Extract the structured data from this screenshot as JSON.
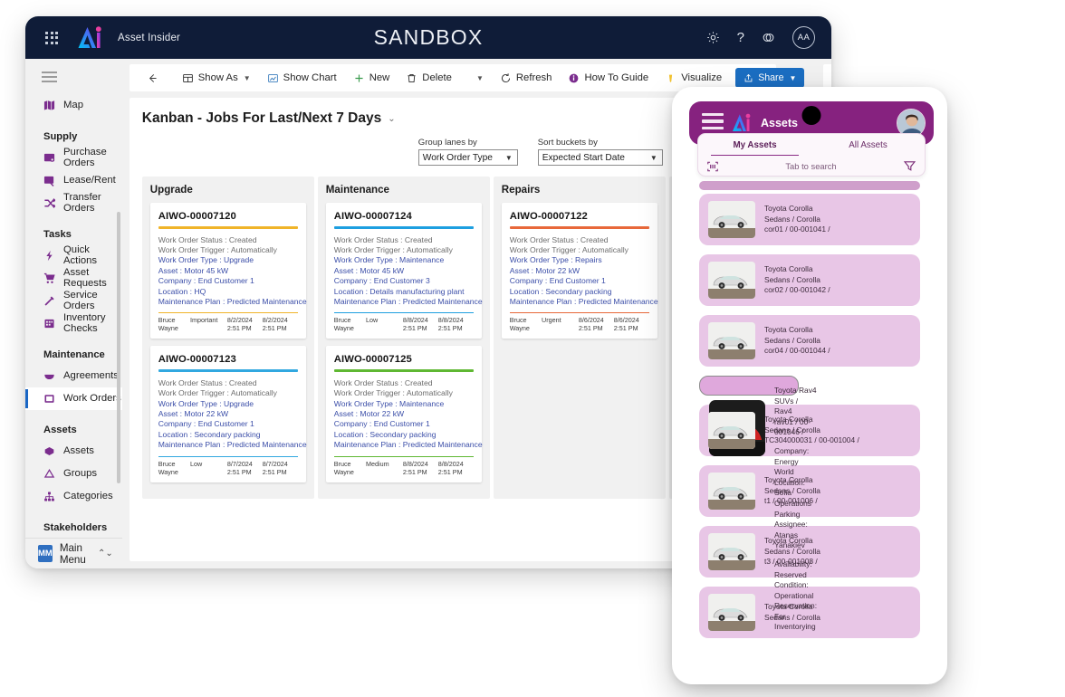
{
  "app": {
    "brand_name": "Asset Insider",
    "environment_label": "SANDBOX",
    "avatar_initials": "AA",
    "icons": {
      "waffle": "app-launcher-icon",
      "settings": "gear-icon",
      "help": "question-mark-icon",
      "feedback": "feedback-icon"
    }
  },
  "sidebar": {
    "top_items": [
      {
        "label": "Map",
        "icon": "map-icon"
      }
    ],
    "groups": [
      {
        "title": "Supply",
        "items": [
          {
            "label": "Purchase Orders",
            "icon": "purchase-order-icon"
          },
          {
            "label": "Lease/Rent",
            "icon": "lease-rent-icon"
          },
          {
            "label": "Transfer Orders",
            "icon": "transfer-icon"
          }
        ]
      },
      {
        "title": "Tasks",
        "items": [
          {
            "label": "Quick Actions",
            "icon": "lightning-icon"
          },
          {
            "label": "Asset Requests",
            "icon": "cart-icon"
          },
          {
            "label": "Service Orders",
            "icon": "wrench-icon"
          },
          {
            "label": "Inventory Checks",
            "icon": "clipboard-icon"
          }
        ]
      },
      {
        "title": "Maintenance",
        "items": [
          {
            "label": "Agreements",
            "icon": "agreement-icon"
          },
          {
            "label": "Work Orders",
            "icon": "work-order-icon",
            "active": true
          }
        ]
      },
      {
        "title": "Assets",
        "items": [
          {
            "label": "Assets",
            "icon": "asset-icon"
          },
          {
            "label": "Groups",
            "icon": "group-icon"
          },
          {
            "label": "Categories",
            "icon": "category-icon"
          }
        ]
      },
      {
        "title": "Stakeholders",
        "items": []
      }
    ],
    "footer": {
      "badge": "MM",
      "label": "Main Menu"
    }
  },
  "toolbar": {
    "back_label": "",
    "show_as": "Show As",
    "show_chart": "Show Chart",
    "new": "New",
    "delete": "Delete",
    "refresh": "Refresh",
    "how_to_guide": "How To Guide",
    "visualize": "Visualize",
    "share": "Share"
  },
  "view": {
    "title": "Kanban - Jobs For Last/Next 7 Days",
    "group_lanes_by": {
      "label": "Group lanes by",
      "value": "Work Order Type"
    },
    "sort_buckets_by": {
      "label": "Sort buckets by",
      "value": "Expected Start Date"
    }
  },
  "kanban": {
    "lanes": [
      {
        "title": "Upgrade",
        "cards": [
          {
            "id": "AIWO-00007120",
            "accent": "#f0b429",
            "fields": [
              {
                "text": "Work Order Status : Created",
                "style": "muted"
              },
              {
                "text": "Work Order Trigger : Automatically",
                "style": "muted"
              },
              {
                "text": "Work Order Type : Upgrade",
                "style": "link"
              },
              {
                "text": "Asset : Motor 45 kW",
                "style": "link"
              },
              {
                "text": "Company : End Customer 1",
                "style": "link"
              },
              {
                "text": "Location : HQ",
                "style": "link"
              },
              {
                "text": "Maintenance Plan : Predicted Maintenance",
                "style": "link"
              }
            ],
            "footer": {
              "owner": "Bruce Wayne",
              "priority": "Important",
              "date1": "8/2/2024",
              "time1": "2:51 PM",
              "date2": "8/2/2024",
              "time2": "2:51 PM"
            }
          },
          {
            "id": "AIWO-00007123",
            "accent": "#31a8e0",
            "fields": [
              {
                "text": "Work Order Status : Created",
                "style": "muted"
              },
              {
                "text": "Work Order Trigger : Automatically",
                "style": "muted"
              },
              {
                "text": "Work Order Type : Upgrade",
                "style": "link"
              },
              {
                "text": "Asset : Motor 22 kW",
                "style": "link"
              },
              {
                "text": "Company : End Customer 1",
                "style": "link"
              },
              {
                "text": "Location : Secondary packing",
                "style": "link"
              },
              {
                "text": "Maintenance Plan : Predicted Maintenance",
                "style": "link"
              }
            ],
            "footer": {
              "owner": "Bruce Wayne",
              "priority": "Low",
              "date1": "8/7/2024",
              "time1": "2:51 PM",
              "date2": "8/7/2024",
              "time2": "2:51 PM"
            }
          }
        ]
      },
      {
        "title": "Maintenance",
        "cards": [
          {
            "id": "AIWO-00007124",
            "accent": "#1e9fe0",
            "fields": [
              {
                "text": "Work Order Status : Created",
                "style": "muted"
              },
              {
                "text": "Work Order Trigger : Automatically",
                "style": "muted"
              },
              {
                "text": "Work Order Type : Maintenance",
                "style": "link"
              },
              {
                "text": "Asset : Motor 45 kW",
                "style": "link"
              },
              {
                "text": "Company : End Customer 3",
                "style": "link"
              },
              {
                "text": "Location : Details manufacturing plant",
                "style": "link"
              },
              {
                "text": "Maintenance Plan : Predicted Maintenance",
                "style": "link"
              }
            ],
            "footer": {
              "owner": "Bruce Wayne",
              "priority": "Low",
              "date1": "8/8/2024",
              "time1": "2:51 PM",
              "date2": "8/8/2024",
              "time2": "2:51 PM"
            }
          },
          {
            "id": "AIWO-00007125",
            "accent": "#5fb832",
            "fields": [
              {
                "text": "Work Order Status : Created",
                "style": "muted"
              },
              {
                "text": "Work Order Trigger : Automatically",
                "style": "muted"
              },
              {
                "text": "Work Order Type : Maintenance",
                "style": "link"
              },
              {
                "text": "Asset : Motor 22 kW",
                "style": "link"
              },
              {
                "text": "Company : End Customer 1",
                "style": "link"
              },
              {
                "text": "Location : Secondary packing",
                "style": "link"
              },
              {
                "text": "Maintenance Plan : Predicted Maintenance",
                "style": "link"
              }
            ],
            "footer": {
              "owner": "Bruce Wayne",
              "priority": "Medium",
              "date1": "8/8/2024",
              "time1": "2:51 PM",
              "date2": "8/8/2024",
              "time2": "2:51 PM"
            }
          }
        ]
      },
      {
        "title": "Repairs",
        "cards": [
          {
            "id": "AIWO-00007122",
            "accent": "#e8683a",
            "fields": [
              {
                "text": "Work Order Status : Created",
                "style": "muted"
              },
              {
                "text": "Work Order Trigger : Automatically",
                "style": "muted"
              },
              {
                "text": "Work Order Type : Repairs",
                "style": "link"
              },
              {
                "text": "Asset : Motor 22 kW",
                "style": "link"
              },
              {
                "text": "Company : End Customer 1",
                "style": "link"
              },
              {
                "text": "Location : Secondary packing",
                "style": "link"
              },
              {
                "text": "Maintenance Plan : Predicted Maintenance",
                "style": "link"
              }
            ],
            "footer": {
              "owner": "Bruce Wayne",
              "priority": "Urgent",
              "date1": "8/6/2024",
              "time1": "2:51 PM",
              "date2": "8/6/2024",
              "time2": "2:51 PM"
            }
          }
        ]
      }
    ]
  },
  "mobile": {
    "title": "Assets",
    "tabs": [
      {
        "label": "My Assets",
        "active": true
      },
      {
        "label": "All Assets",
        "active": false
      }
    ],
    "search_placeholder": "Tab to search",
    "icons": {
      "scan": "barcode-scan-icon",
      "filter": "funnel-icon",
      "menu": "hamburger-icon"
    },
    "assets": [
      {
        "name": "Toyota Corolla",
        "category": "Sedans / Corolla",
        "code": "cor01 / 00-001041 /",
        "kind": "sedan",
        "selected": false
      },
      {
        "name": "Toyota Corolla",
        "category": "Sedans / Corolla",
        "code": "cor02 / 00-001042 /",
        "kind": "sedan",
        "selected": false
      },
      {
        "name": "Toyota Corolla",
        "category": "Sedans / Corolla",
        "code": "cor04 / 00-001044 /",
        "kind": "sedan",
        "selected": false
      },
      {
        "name": "Toyota Rav4",
        "category": "SUVs / Rav4",
        "code": "rav01 / 00-001046 /",
        "kind": "suv",
        "selected": true,
        "details": [
          "Company: Energy World",
          "Location: Sofia Operations Parking",
          "Assignee: Atanas Yanakiev"
        ],
        "status": [
          "Availability: Reserved",
          "Condition: Operational",
          "Reservation: For Inventorying"
        ]
      },
      {
        "name": "Toyota Corolla",
        "category": "Sedans / Corolla",
        "code": "TC304000031 / 00-001004 /",
        "kind": "sedan",
        "selected": false
      },
      {
        "name": "Toyota Corolla",
        "category": "Sedans / Corolla",
        "code": "t1 / 00-001006 /",
        "kind": "sedan",
        "selected": false
      },
      {
        "name": "Toyota Corolla",
        "category": "Sedans / Corolla",
        "code": "t3 / 00-001008 /",
        "kind": "sedan",
        "selected": false
      },
      {
        "name": "Toyota Corolla",
        "category": "Sedans / Corolla",
        "code": "",
        "kind": "sedan",
        "selected": false
      }
    ]
  },
  "colors": {
    "header_bg": "#0f1c38",
    "accent_purple": "#86227f",
    "sidebar_icon": "#7b2d8e",
    "share_blue": "#1b6ec2"
  }
}
